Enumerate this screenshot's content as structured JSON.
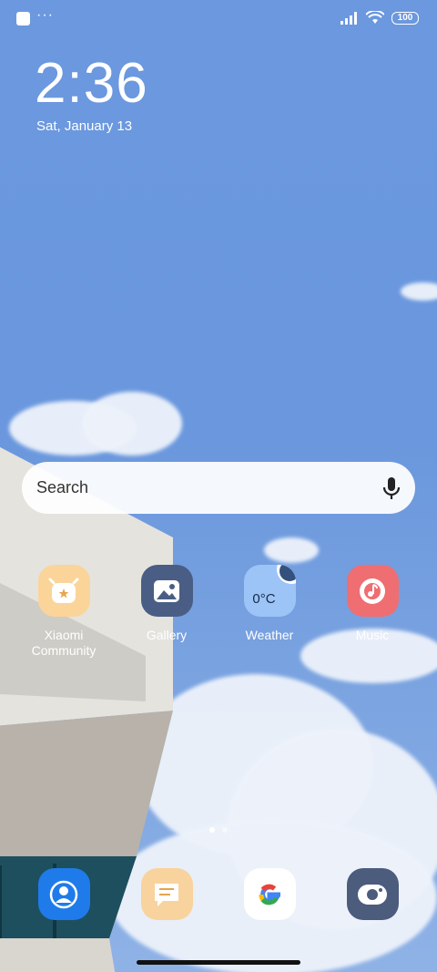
{
  "status_bar": {
    "menu_dots": "···",
    "battery": "100"
  },
  "lockscreen": {
    "time": "2:36",
    "date": "Sat, January 13"
  },
  "search": {
    "placeholder": "Search"
  },
  "apps": [
    {
      "label": "Xiaomi Community",
      "icon": "xiaomi-community-icon",
      "color": "#fbd49a"
    },
    {
      "label": "Gallery",
      "icon": "gallery-icon",
      "color": "#4a5e85"
    },
    {
      "label": "Weather",
      "icon": "weather-icon",
      "color": "#9cc4f7",
      "value": "0°C"
    },
    {
      "label": "Music",
      "icon": "music-icon",
      "color": "#ef6e72"
    }
  ],
  "dock": [
    {
      "icon": "contacts-icon",
      "color": "#1f7bea"
    },
    {
      "icon": "notes-icon",
      "color": "#f9d39d"
    },
    {
      "icon": "google-icon",
      "color": "#ffffff"
    },
    {
      "icon": "camera-icon",
      "color": "#4b5c7d"
    }
  ],
  "pager": {
    "pages": 2,
    "current": 1
  }
}
